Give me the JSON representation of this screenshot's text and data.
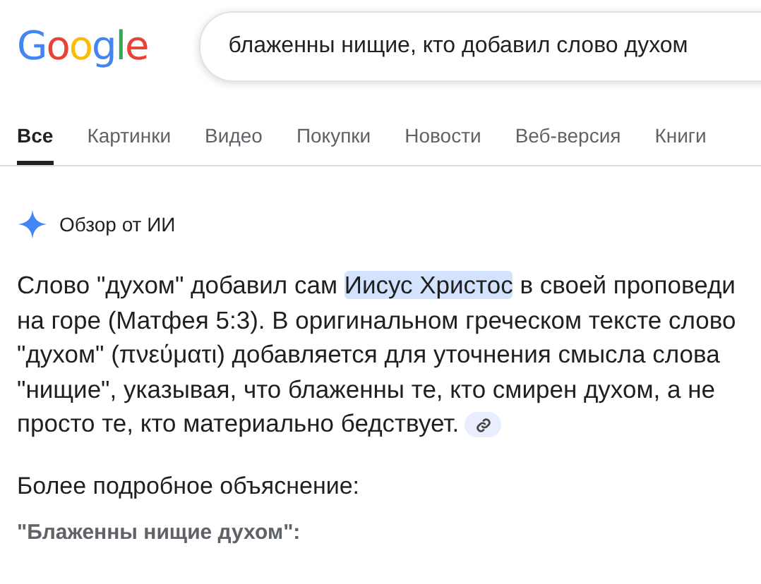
{
  "logo": "Google",
  "search": {
    "value": "блаженны нищие, кто добавил слово духом"
  },
  "tabs": [
    {
      "label": "Все",
      "selected": true
    },
    {
      "label": "Картинки",
      "selected": false
    },
    {
      "label": "Видео",
      "selected": false
    },
    {
      "label": "Покупки",
      "selected": false
    },
    {
      "label": "Новости",
      "selected": false
    },
    {
      "label": "Веб-версия",
      "selected": false
    },
    {
      "label": "Книги",
      "selected": false
    }
  ],
  "ai_overview": {
    "title": "Обзор от ИИ",
    "paragraph": [
      {
        "text": "Слово \"духом\" добавил сам ",
        "highlighted": false
      },
      {
        "text": "Иисус Христос",
        "highlighted": true
      },
      {
        "text": " в своей проповеди на горе (Матфея 5:3). В оригинальном греческом тексте слово \"духом\" (πνεύματι) добавляется для уточнения смысла слова \"нищие\", указывая, что блаженны те, кто смирен духом, а не просто те, кто материально бедствует.",
        "highlighted": false
      }
    ],
    "heading": "Более подробное объяснение:",
    "subheading": "\"Блаженны нищие духом\":"
  }
}
